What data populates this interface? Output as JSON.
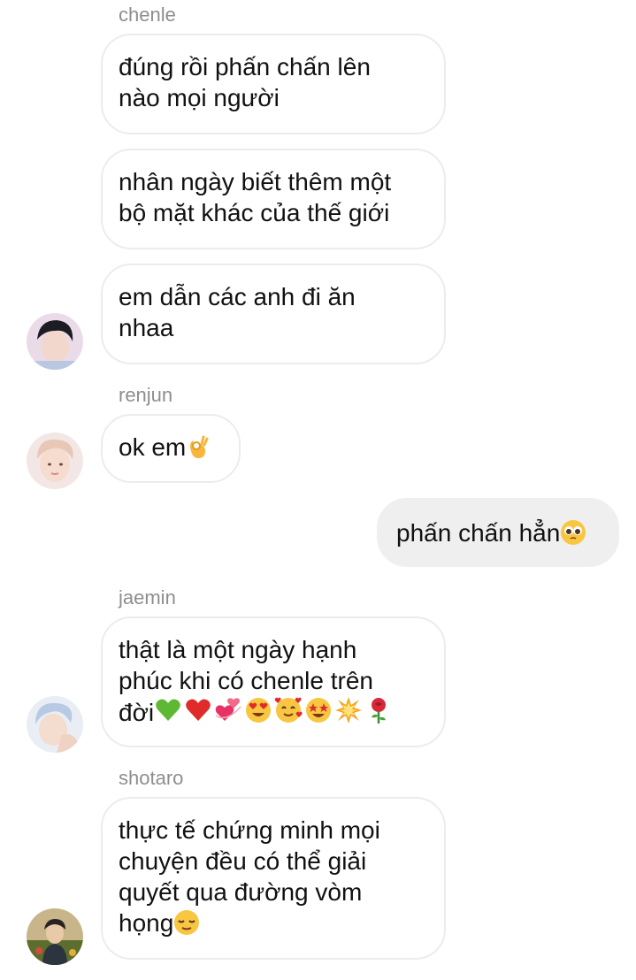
{
  "messages": [
    {
      "sender": "chenle"
    },
    {
      "text": "đúng rồi phấn chấn lên nào mọi người"
    },
    {
      "text": "nhân ngày biết thêm một bộ mặt khác của thế giới"
    },
    {
      "text": "em dẫn các anh đi ăn nhaa"
    },
    {
      "sender": "renjun"
    },
    {
      "text": "ok em",
      "emoji": [
        "ok-hand"
      ]
    },
    {
      "text": "phấn chấn hẳn",
      "emoji": [
        "pleading-face"
      ]
    },
    {
      "sender": "jaemin"
    },
    {
      "text": "thật là một ngày hạnh phúc khi có chenle trên đời",
      "emoji": [
        "green-heart",
        "red-heart",
        "revolving-hearts",
        "heart-eyes",
        "smiling-hearts",
        "star-struck",
        "collision",
        "rose"
      ]
    },
    {
      "sender": "shotaro"
    },
    {
      "text": "thực tế chứng minh mọi chuyện đều có thể giải quyết qua đường vòm họng",
      "emoji": [
        "relieved-face"
      ]
    }
  ],
  "chat": {
    "sender_1": "chenle",
    "line_1a": "đúng rồi phấn chấn lên",
    "line_1b": "nào mọi người",
    "line_2a": "nhân ngày biết thêm một",
    "line_2b": "bộ mặt khác của thế giới",
    "line_3a": "em dẫn các anh đi ăn",
    "line_3b": "nhaa",
    "sender_2": "renjun",
    "line_4": "ok em",
    "line_mine": "phấn chấn hẳn",
    "sender_3": "jaemin",
    "line_6a": "thật là một ngày hạnh",
    "line_6b": "phúc khi có chenle trên",
    "line_6c": "đời",
    "sender_4": "shotaro",
    "line_7a": "thực tế chứng minh mọi",
    "line_7b": "chuyện đều có thể giải",
    "line_7c": "quyết qua đường vòm",
    "line_7d": "họng"
  },
  "colors": {
    "sender_name": "#8e8e8e",
    "bubble_border": "#ececec",
    "my_bubble": "#efefef"
  }
}
